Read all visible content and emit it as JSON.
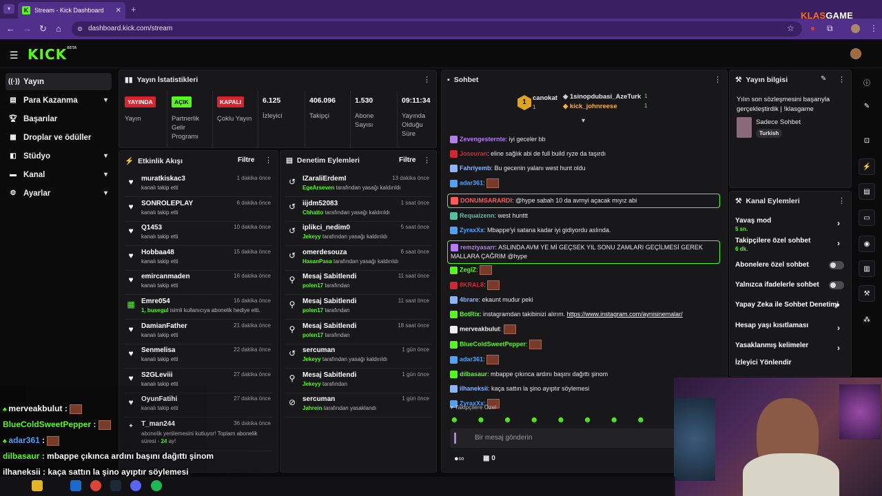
{
  "browser": {
    "tab_title": "Stream - Kick Dashboard",
    "tab_favicon": "K",
    "url": "dashboard.kick.com/stream",
    "watermark_a": "KLAS",
    "watermark_b": "GAME"
  },
  "kick": {
    "logo": "KICK",
    "logo_sup": "BETA"
  },
  "sidebar": {
    "items": [
      {
        "label": "Yayın",
        "icon": "broadcast-icon"
      },
      {
        "label": "Para Kazanma",
        "icon": "money-icon"
      },
      {
        "label": "Başarılar",
        "icon": "trophy-icon"
      },
      {
        "label": "Droplar ve ödüller",
        "icon": "gift-icon"
      },
      {
        "label": "Stüdyo",
        "icon": "studio-icon"
      },
      {
        "label": "Kanal",
        "icon": "channel-icon"
      },
      {
        "label": "Ayarlar",
        "icon": "gear-icon"
      }
    ]
  },
  "stats": {
    "title": "Yayın İstatistikleri",
    "cols": [
      {
        "value": "YAYINDA",
        "label": "Yayın"
      },
      {
        "value": "AÇIK",
        "label": "Partnerlik Gelir Programı"
      },
      {
        "value": "KAPALI",
        "label": "Çoklu Yayın"
      },
      {
        "value": "6.125",
        "label": "İzleyici"
      },
      {
        "value": "406.096",
        "label": "Takipçi"
      },
      {
        "value": "1.530",
        "label": "Abone Sayısı"
      },
      {
        "value": "09:11:34",
        "label": "Yayında Olduğu Süre"
      }
    ],
    "colors": {
      "live": "#d9232e",
      "on": "#53fc18",
      "off": "#d9232e"
    }
  },
  "activity": {
    "title": "Etkinlik Akışı",
    "filter": "Filtre",
    "rows": [
      {
        "name": "muratkiskac3",
        "sub": "kanalı takip etti",
        "time": "1 dakika önce"
      },
      {
        "name": "SONROLEPLAY",
        "sub": "kanalı takip etti",
        "time": "6 dakika önce"
      },
      {
        "name": "Q1453",
        "sub": "kanalı takip etti",
        "time": "10 dakika önce"
      },
      {
        "name": "Hobbaa48",
        "sub": "kanalı takip etti",
        "time": "15 dakika önce"
      },
      {
        "name": "emircanmaden",
        "sub": "kanalı takip etti",
        "time": "16 dakika önce"
      },
      {
        "name": "Emre054",
        "sub_b": "1, busegul",
        "sub": " isimli kullanıcıya abonelik hediye etti.",
        "time": "16 dakika önce"
      },
      {
        "name": "DamianFather",
        "sub": "kanalı takip etti",
        "time": "21 dakika önce"
      },
      {
        "name": "Senmelisa",
        "sub": "kanalı takip etti",
        "time": "22 dakika önce"
      },
      {
        "name": "S2GLeviii",
        "sub": "kanalı takip etti",
        "time": "27 dakika önce"
      },
      {
        "name": "OyunFatihi",
        "sub": "kanalı takip etti",
        "time": "27 dakika önce"
      }
    ],
    "last": {
      "name": "T_man244",
      "sub": "abonelik yenilemesini kutluyor! Toplam abonelik süresi - ",
      "sub_b": "24",
      "sub_c": " ay!",
      "time": "36 dakika önce"
    }
  },
  "moderation": {
    "title": "Denetim Eylemleri",
    "filter": "Filtre",
    "rows": [
      {
        "name": "IZaraliErdemI",
        "by": "EgeArseven",
        "action": " tarafından yasağı kaldırıldı",
        "time": "13 dakika önce",
        "icon": "undo-icon"
      },
      {
        "name": "iijdm52083",
        "by": "Chhatto",
        "action": " tarafından yasağı kaldırıldı",
        "time": "1 saat önce",
        "icon": "undo-icon"
      },
      {
        "name": "iplikci_nedim0",
        "by": "Jekeyy",
        "action": " tarafından yasağı kaldırıldı",
        "time": "5 saat önce",
        "icon": "undo-icon"
      },
      {
        "name": "omerdesouza",
        "by": "HasanPasa",
        "action": " tarafından yasağı kaldırıldı",
        "time": "6 saat önce",
        "icon": "undo-icon"
      },
      {
        "name": "Mesaj Sabitlendi",
        "by": "polen17",
        "action": " tarafından",
        "time": "11 saat önce",
        "icon": "pin-icon"
      },
      {
        "name": "Mesaj Sabitlendi",
        "by": "polen17",
        "action": " tarafından",
        "time": "11 saat önce",
        "icon": "pin-icon"
      },
      {
        "name": "Mesaj Sabitlendi",
        "by": "polen17",
        "action": " tarafından",
        "time": "18 saat önce",
        "icon": "pin-icon"
      },
      {
        "name": "sercuman",
        "by": "Jekeyy",
        "action": " tarafından yasağı kaldırıldı",
        "time": "1 gün önce",
        "icon": "undo-icon"
      },
      {
        "name": "Mesaj Sabitlendi",
        "by": "Jekeyy",
        "action": " tarafından",
        "time": "1 gün önce",
        "icon": "pin-icon"
      },
      {
        "name": "sercuman",
        "by": "Jahrein",
        "action": " tarafından yasaklandı",
        "time": "1 gün önce",
        "icon": "ban-icon"
      }
    ]
  },
  "chat": {
    "title": "Sohbet",
    "top": [
      {
        "rank": "1",
        "name": "canokat",
        "count": "1"
      },
      {
        "name": "1sinopdubasi_AzeTurk",
        "count": "1"
      },
      {
        "name": "kick_johnreese",
        "count": "1"
      }
    ],
    "messages": [
      {
        "user": "Zevengesternte",
        "color": "#b57cf5",
        "text": "iyi geceler bb"
      },
      {
        "user": "Joseuran",
        "color": "#d9232e",
        "text": "eline sağlık abi de full build ryze da taşırdı"
      },
      {
        "user": "Fahriyemb",
        "color": "#8ab4ff",
        "text": "Bu gecenin yalanı west hunt oldu"
      },
      {
        "user": "adar361",
        "color": "#4ea1ff",
        "text": ""
      },
      {
        "user": "DONUMSARARDI",
        "color": "#ff5a5a",
        "text": "@hype sabah 10 da avmyi açacak mıyız abi",
        "hl": true
      },
      {
        "user": "Requaizenn",
        "color": "#53c0a0",
        "text": "west hunttt"
      },
      {
        "user": "ZyraxXx",
        "color": "#4ea1ff",
        "text": "Mbappe'yi satana kadar iyi gidiyordu aslında."
      },
      {
        "user": "remziyasarr",
        "color": "#b57cf5",
        "text": "ASLINDA AVM YE Mİ GEÇSEK YIL SONU ZAMLARI GEÇİLMESİ GEREK MALLARA ÇAĞRIM @hype",
        "hl": true
      },
      {
        "user": "ZegiZ",
        "color": "#53fc18",
        "text": ""
      },
      {
        "user": "8KRAL8",
        "color": "#d9232e",
        "text": ""
      },
      {
        "user": "4brare",
        "color": "#8ab4ff",
        "text": "ekaunt mudur peki"
      },
      {
        "user": "BotRix",
        "color": "#53fc18",
        "text": "instagramdan takibinizi alırım. ",
        "link": "https://www.instagram.com/aynisinemalar/"
      },
      {
        "user": "merveakbulut",
        "color": "#f0f0f0",
        "text": ""
      },
      {
        "user": "BlueColdSweetPepper",
        "color": "#53fc18",
        "text": ""
      },
      {
        "user": "adar361",
        "color": "#4ea1ff",
        "text": ""
      },
      {
        "user": "dilbasaur",
        "color": "#53fc18",
        "text": "mbappe çıkınca ardını başını dağıttı şinom"
      },
      {
        "user": "ilhaneksii",
        "color": "#8ab4ff",
        "text": "kaça sattın la şino ayıptır söylemesi"
      },
      {
        "user": "ZyraxXx",
        "color": "#4ea1ff",
        "text": ""
      }
    ],
    "followers_only": "Takipçilere Özel",
    "input_placeholder": "Bir mesaj gönderin",
    "footer_count": "0"
  },
  "stream_info": {
    "title": "Yayın bilgisi",
    "stream_title": "Yılın son sözleşmesini başarıyla gerçekleştirdik | !klasgame",
    "category": "Sadece Sohbet",
    "language": "Turkish"
  },
  "channel_actions": {
    "title": "Kanal Eylemleri",
    "items": [
      {
        "label": "Yavaş mod",
        "sub": "5 sn.",
        "type": "chev"
      },
      {
        "label": "Takipçilere özel sohbet",
        "sub": "6 dk.",
        "type": "chev"
      },
      {
        "label": "Abonelere özel sohbet",
        "type": "toggle"
      },
      {
        "label": "Yalnızca ifadelerle sohbet",
        "type": "toggle"
      },
      {
        "label": "Yapay Zeka ile Sohbet Denetimi",
        "type": "ext"
      },
      {
        "label": "Hesap yaşı kısıtlaması",
        "type": "chev"
      },
      {
        "label": "Yasaklanmış kelimeler",
        "type": "chev"
      },
      {
        "label": "İzleyici Yönlendir",
        "type": "none"
      }
    ]
  },
  "overlay": {
    "lines": [
      {
        "user": "merveakbulut",
        "color": "#ffffff",
        "text": ""
      },
      {
        "user": "BlueColdSweetPepper",
        "color": "#53fc18",
        "text": ""
      },
      {
        "user": "adar361",
        "color": "#4ea1ff",
        "text": ""
      },
      {
        "user": "dilbasaur",
        "color": "#53fc18",
        "text": "mbappe çıkınca ardını başını dağıttı şinom"
      },
      {
        "user": "ilhaneksii",
        "color": "#ffffff",
        "text": "kaça sattın la şino ayıptır söylemesi"
      }
    ]
  }
}
